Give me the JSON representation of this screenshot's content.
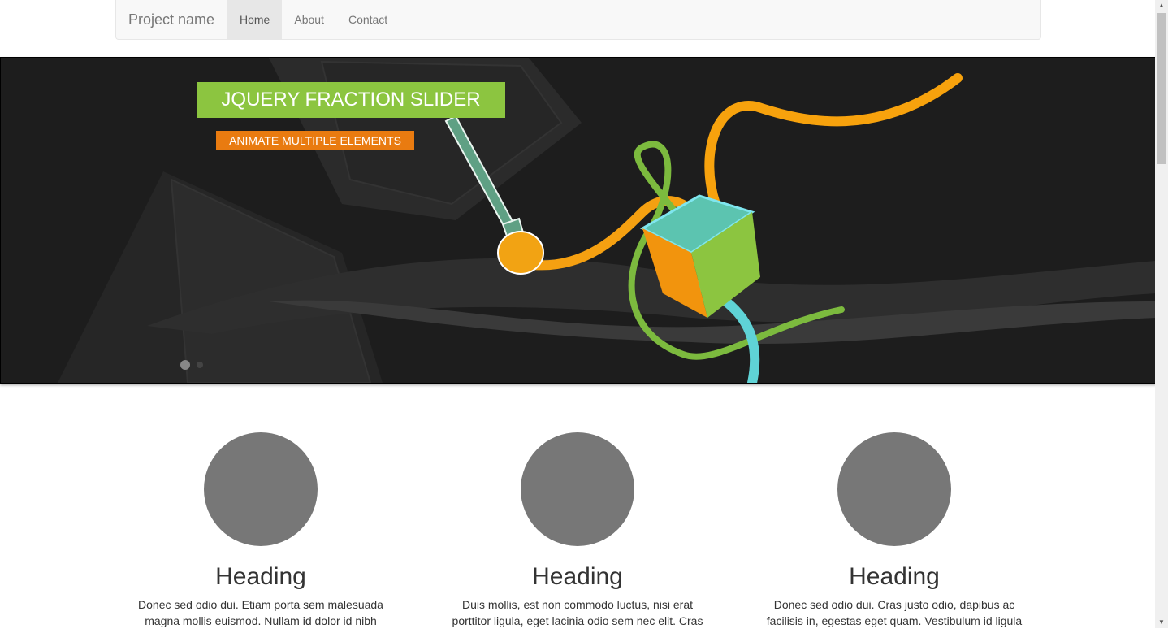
{
  "navbar": {
    "brand": "Project name",
    "items": [
      {
        "label": "Home",
        "active": true
      },
      {
        "label": "About",
        "active": false
      },
      {
        "label": "Contact",
        "active": false
      }
    ]
  },
  "slider": {
    "title": "JQUERY FRACTION SLIDER",
    "subtitle": "ANIMATE MULTIPLE ELEMENTS",
    "slide_count": 2,
    "active_slide": 1,
    "colors": {
      "title_bg": "#8cc540",
      "subtitle_bg": "#e97b10",
      "background": "#1d1d1d"
    }
  },
  "columns": [
    {
      "heading": "Heading",
      "text": "Donec sed odio dui. Etiam porta sem malesuada magna mollis euismod. Nullam id dolor id nibh"
    },
    {
      "heading": "Heading",
      "text": "Duis mollis, est non commodo luctus, nisi erat porttitor ligula, eget lacinia odio sem nec elit. Cras"
    },
    {
      "heading": "Heading",
      "text": "Donec sed odio dui. Cras justo odio, dapibus ac facilisis in, egestas eget quam. Vestibulum id ligula"
    }
  ]
}
